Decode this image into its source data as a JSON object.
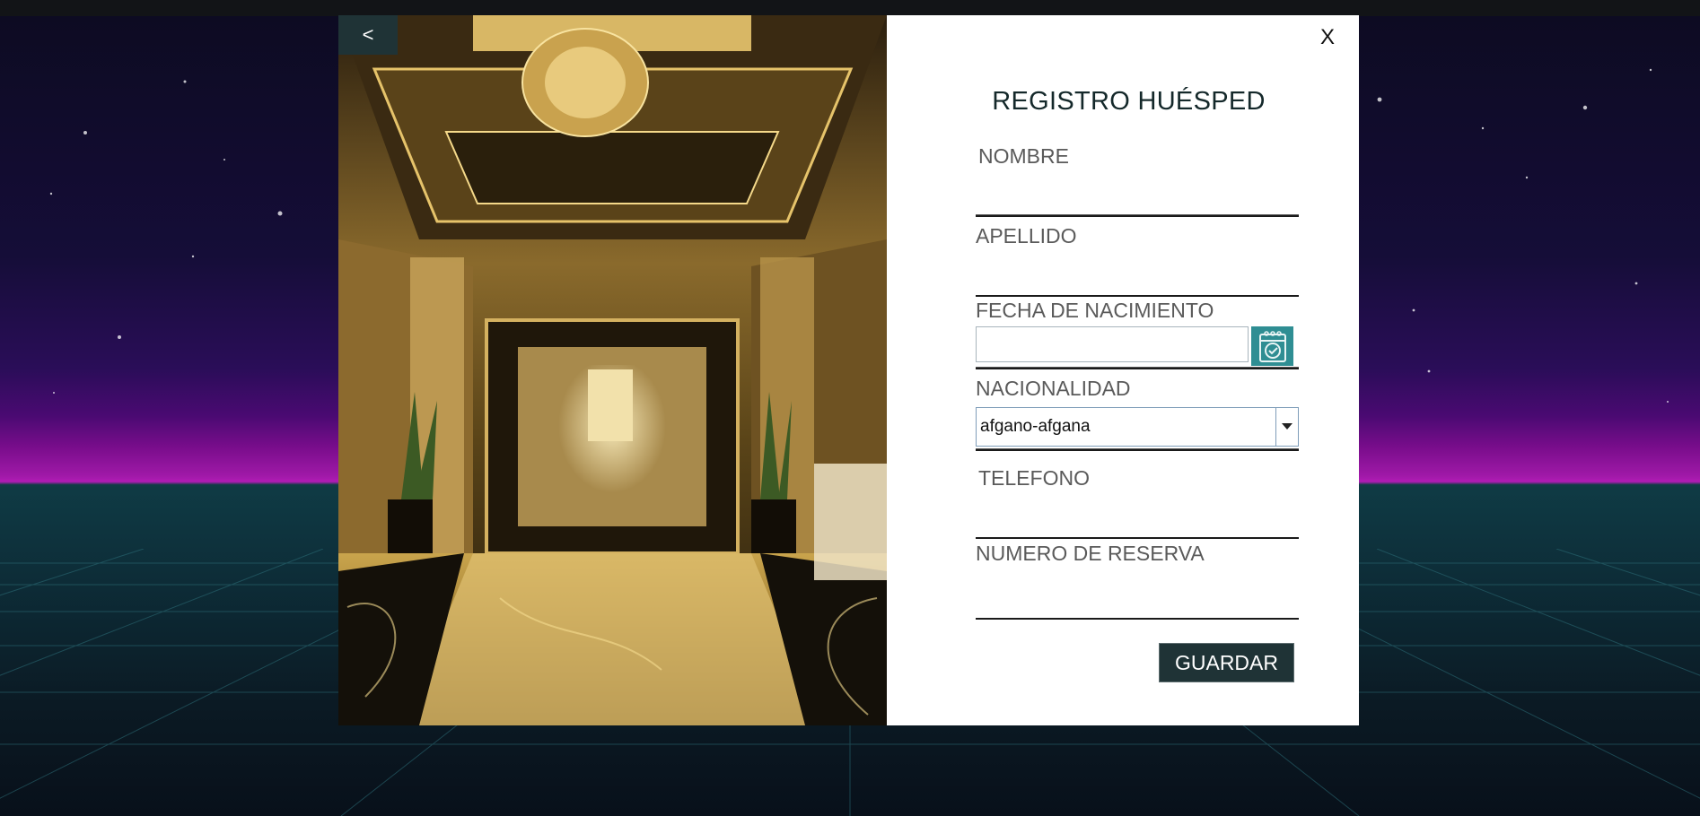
{
  "window": {
    "back_label": "<",
    "close_label": "X"
  },
  "form": {
    "title": "REGISTRO HUÉSPED",
    "fields": {
      "nombre": {
        "label": "NOMBRE",
        "value": ""
      },
      "apellido": {
        "label": "APELLIDO",
        "value": ""
      },
      "fecha_nacimiento": {
        "label": "FECHA DE NACIMIENTO",
        "value": ""
      },
      "nacionalidad": {
        "label": "NACIONALIDAD",
        "selected": "afgano-afgana"
      },
      "telefono": {
        "label": "TELEFONO",
        "value": ""
      },
      "numero_reserva": {
        "label": "NUMERO DE RESERVA",
        "value": ""
      }
    },
    "save_label": "GUARDAR"
  },
  "icons": {
    "calendar": "calendar-check-icon",
    "dropdown": "chevron-down-icon"
  },
  "colors": {
    "dark_teal": "#1f3336",
    "calendar_teal": "#2f8e93",
    "title": "#14282a",
    "label": "#5a5a5a"
  }
}
